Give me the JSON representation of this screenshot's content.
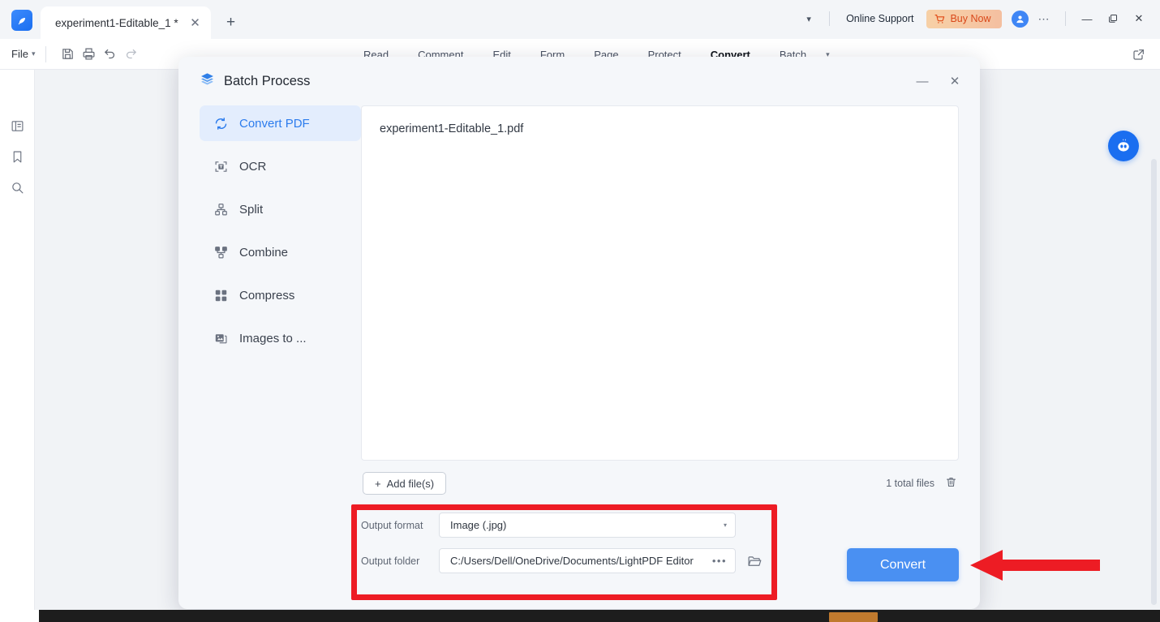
{
  "titlebar": {
    "logo_icon": "lightpdf-logo-icon",
    "tab": {
      "label": "experiment1-Editable_1 *",
      "close_icon": "close-icon"
    },
    "new_tab_icon": "plus-icon",
    "chevron_icon": "chevron-down-icon",
    "online_support": "Online Support",
    "buy_now": "Buy Now",
    "buy_now_icon": "cart-icon",
    "avatar_icon": "user-avatar-icon",
    "more_icon": "more-horizontal-icon",
    "minimize": "—",
    "maximize": "❐",
    "close": "✕"
  },
  "ribbon": {
    "file_label": "File",
    "file_caret": "˅",
    "tools": [
      "save-icon",
      "print-icon",
      "undo-icon",
      "redo-icon"
    ],
    "tabs": [
      {
        "label": "Read",
        "active": false
      },
      {
        "label": "Comment",
        "active": false
      },
      {
        "label": "Edit",
        "active": false
      },
      {
        "label": "Form",
        "active": false
      },
      {
        "label": "Page",
        "active": false
      },
      {
        "label": "Protect",
        "active": false
      },
      {
        "label": "Convert",
        "active": true
      },
      {
        "label": "Batch",
        "active": false
      }
    ],
    "overflow_caret": "˅",
    "share_icon": "external-link-icon"
  },
  "rail": {
    "items": [
      "thumbnails-icon",
      "bookmark-icon",
      "search-icon"
    ]
  },
  "canvas": {
    "ai_assistant_icon": "ai-assistant-icon",
    "scrollbar": "vertical-scrollbar"
  },
  "dialog": {
    "title": "Batch Process",
    "title_icon": "layers-icon",
    "minimize_label": "—",
    "close_label": "✕",
    "sidebar": [
      {
        "label": "Convert PDF",
        "icon": "convert-refresh-icon",
        "active": true
      },
      {
        "label": "OCR",
        "icon": "ocr-icon",
        "active": false
      },
      {
        "label": "Split",
        "icon": "split-icon",
        "active": false
      },
      {
        "label": "Combine",
        "icon": "combine-icon",
        "active": false
      },
      {
        "label": "Compress",
        "icon": "compress-icon",
        "active": false
      },
      {
        "label": "Images to ...",
        "icon": "images-to-pdf-icon",
        "active": false
      }
    ],
    "files": [
      {
        "name": "experiment1-Editable_1.pdf"
      }
    ],
    "add_files_label": "Add file(s)",
    "add_files_icon": "plus-icon",
    "total_files_label": "1 total files",
    "delete_icon": "trash-icon",
    "output_format_label": "Output format",
    "output_format_value": "Image (.jpg)",
    "output_format_caret": "▾",
    "output_folder_label": "Output folder",
    "output_folder_value": "C:/Users/Dell/OneDrive/Documents/LightPDF Editor",
    "output_folder_dots": "•••",
    "browse_icon": "folder-open-icon",
    "convert_label": "Convert"
  },
  "annotations": {
    "highlight_box_color": "#ed1c24",
    "arrow_color": "#ed1c24",
    "arrow_icon": "left-arrow-annotation"
  },
  "colors": {
    "accent_blue": "#4a90f2",
    "active_item_bg": "#e3edfd",
    "active_item_text": "#2c7ced",
    "buy_now_text": "#d9481a",
    "window_bg": "#f1f3f6"
  }
}
